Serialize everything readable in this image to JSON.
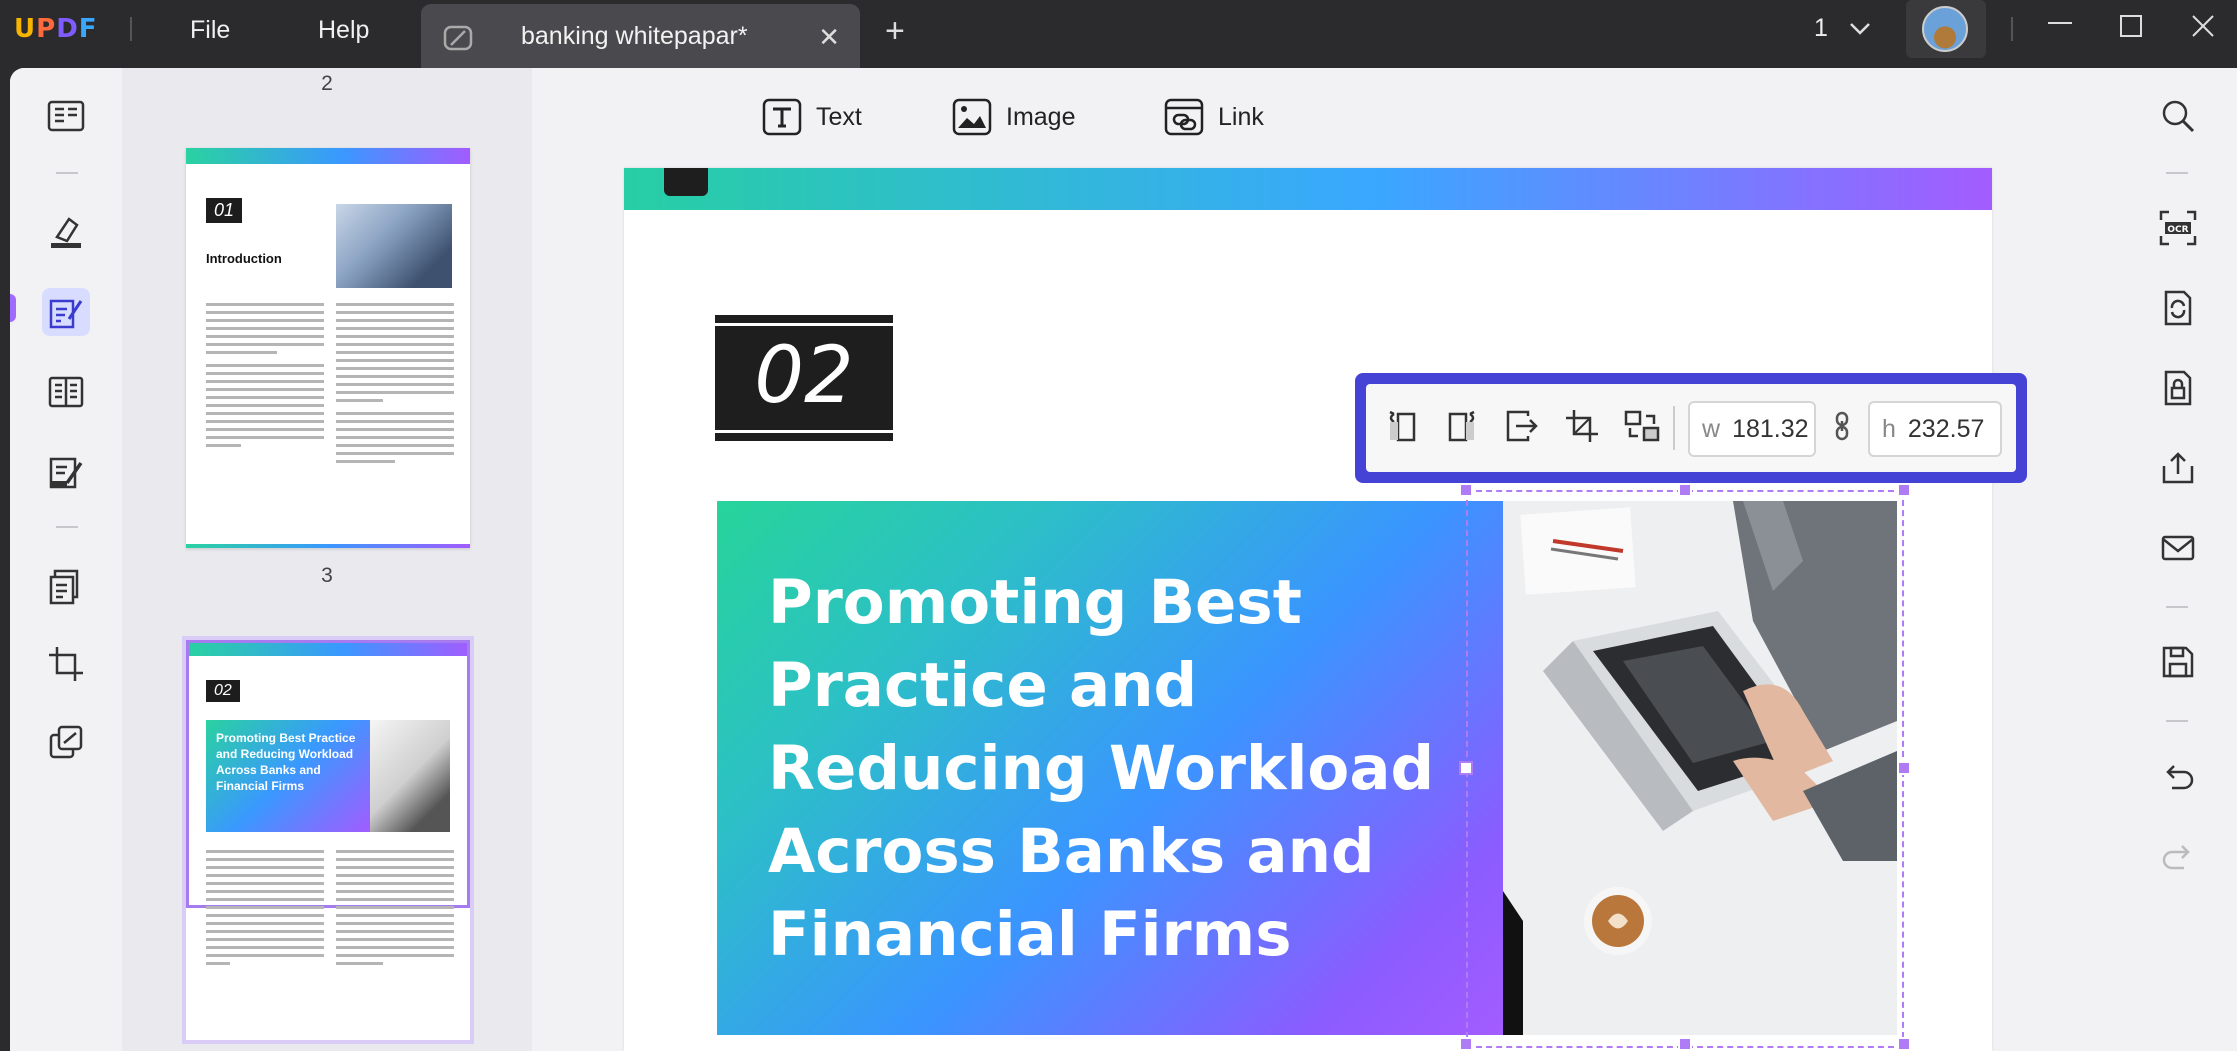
{
  "app": {
    "logo": "UPDF"
  },
  "menu": {
    "file": "File",
    "help": "Help"
  },
  "tab": {
    "title": "banking whitepapar*",
    "close": "✕",
    "add": "+"
  },
  "page_selector": {
    "value": "1"
  },
  "edit_toolbar": {
    "text_label": "Text",
    "image_label": "Image",
    "link_label": "Link"
  },
  "thumbnails": {
    "page2_number": "2",
    "page3_number": "3",
    "page2": {
      "section_num": "01",
      "title": "Introduction"
    },
    "page3": {
      "section_num": "02",
      "title": "Promoting Best Practice and Reducing Workload Across Banks and Financial Firms"
    }
  },
  "page": {
    "section_number": "02",
    "hero_title": "Promoting Best Practice and Reducing Workload Across Banks and Financial Firms"
  },
  "image_toolbar": {
    "width_label": "w",
    "width_value": "181.32",
    "height_label": "h",
    "height_value": "232.57"
  },
  "colors": {
    "accent": "#4542d6",
    "selection": "#b07cf5",
    "active_tool_bg": "#d8dcff"
  }
}
